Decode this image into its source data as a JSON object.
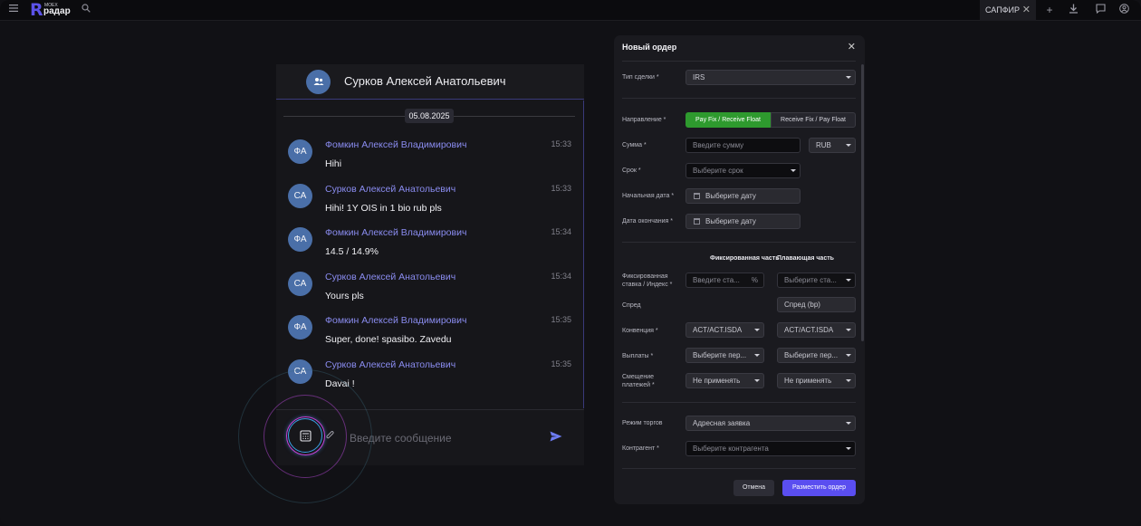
{
  "topbar": {
    "logo_small": "MOEX",
    "logo_main": "радар",
    "tab_label": "САПФИР"
  },
  "chat": {
    "header_name": "Сурков Алексей Анатольевич",
    "date": "05.08.2025",
    "messages": [
      {
        "initials": "ФА",
        "author": "Фомкин Алексей Владимирович",
        "time": "15:33",
        "text": "Hihi"
      },
      {
        "initials": "СА",
        "author": "Сурков Алексей Анатольевич",
        "time": "15:33",
        "text": "Hihi! 1Y OIS in 1 bio rub pls"
      },
      {
        "initials": "ФА",
        "author": "Фомкин Алексей Владимирович",
        "time": "15:34",
        "text": "14.5 / 14.9%"
      },
      {
        "initials": "СА",
        "author": "Сурков Алексей Анатольевич",
        "time": "15:34",
        "text": "Yours pls"
      },
      {
        "initials": "ФА",
        "author": "Фомкин Алексей Владимирович",
        "time": "15:35",
        "text": "Super, done! spasibo. Zavedu"
      },
      {
        "initials": "СА",
        "author": "Сурков Алексей Анатольевич",
        "time": "15:35",
        "text": "Davai !"
      }
    ],
    "input_placeholder": "Введите сообщение"
  },
  "order": {
    "title": "Новый ордер",
    "deal_type_label": "Тип сделки *",
    "deal_type_value": "IRS",
    "direction_label": "Направление *",
    "direction_options": [
      "Pay Fix / Receive Float",
      "Receive Fix / Pay Float"
    ],
    "amount_label": "Сумма *",
    "amount_placeholder": "Введите сумму",
    "currency_value": "RUB",
    "term_label": "Срок *",
    "term_placeholder": "Выберите срок",
    "start_date_label": "Начальная дата *",
    "start_date_placeholder": "Выберите дату",
    "end_date_label": "Дата окончания *",
    "end_date_placeholder": "Выберите дату",
    "fixed_col": "Фиксированная часть",
    "float_col": "Плавающая часть",
    "rate_label": "Фиксированная ставка / Индекс *",
    "rate_placeholder": "Введите ста...",
    "rate_unit": "%",
    "index_placeholder": "Выберите ста...",
    "spread_label": "Спред",
    "spread_placeholder": "Спред (bp)",
    "convention_label": "Конвенция *",
    "convention_fixed": "ACT/ACT.ISDA",
    "convention_float": "ACT/ACT.ISDA",
    "payments_label": "Выплаты *",
    "payments_fixed": "Выберите пер...",
    "payments_float": "Выберите пер...",
    "shift_label": "Смещение платежей *",
    "shift_fixed": "Не применять",
    "shift_float": "Не применять",
    "trade_mode_label": "Режим торгов",
    "trade_mode_value": "Адресная заявка",
    "counterparty_label": "Контрагент *",
    "counterparty_placeholder": "Выберите контрагента",
    "cancel_label": "Отмена",
    "submit_label": "Разместить ордер"
  },
  "colors": {
    "accent": "#5a4ef0",
    "active_green": "#2e9a2e",
    "author_link": "#8a8cf0",
    "avatar": "#4a6fa8"
  }
}
